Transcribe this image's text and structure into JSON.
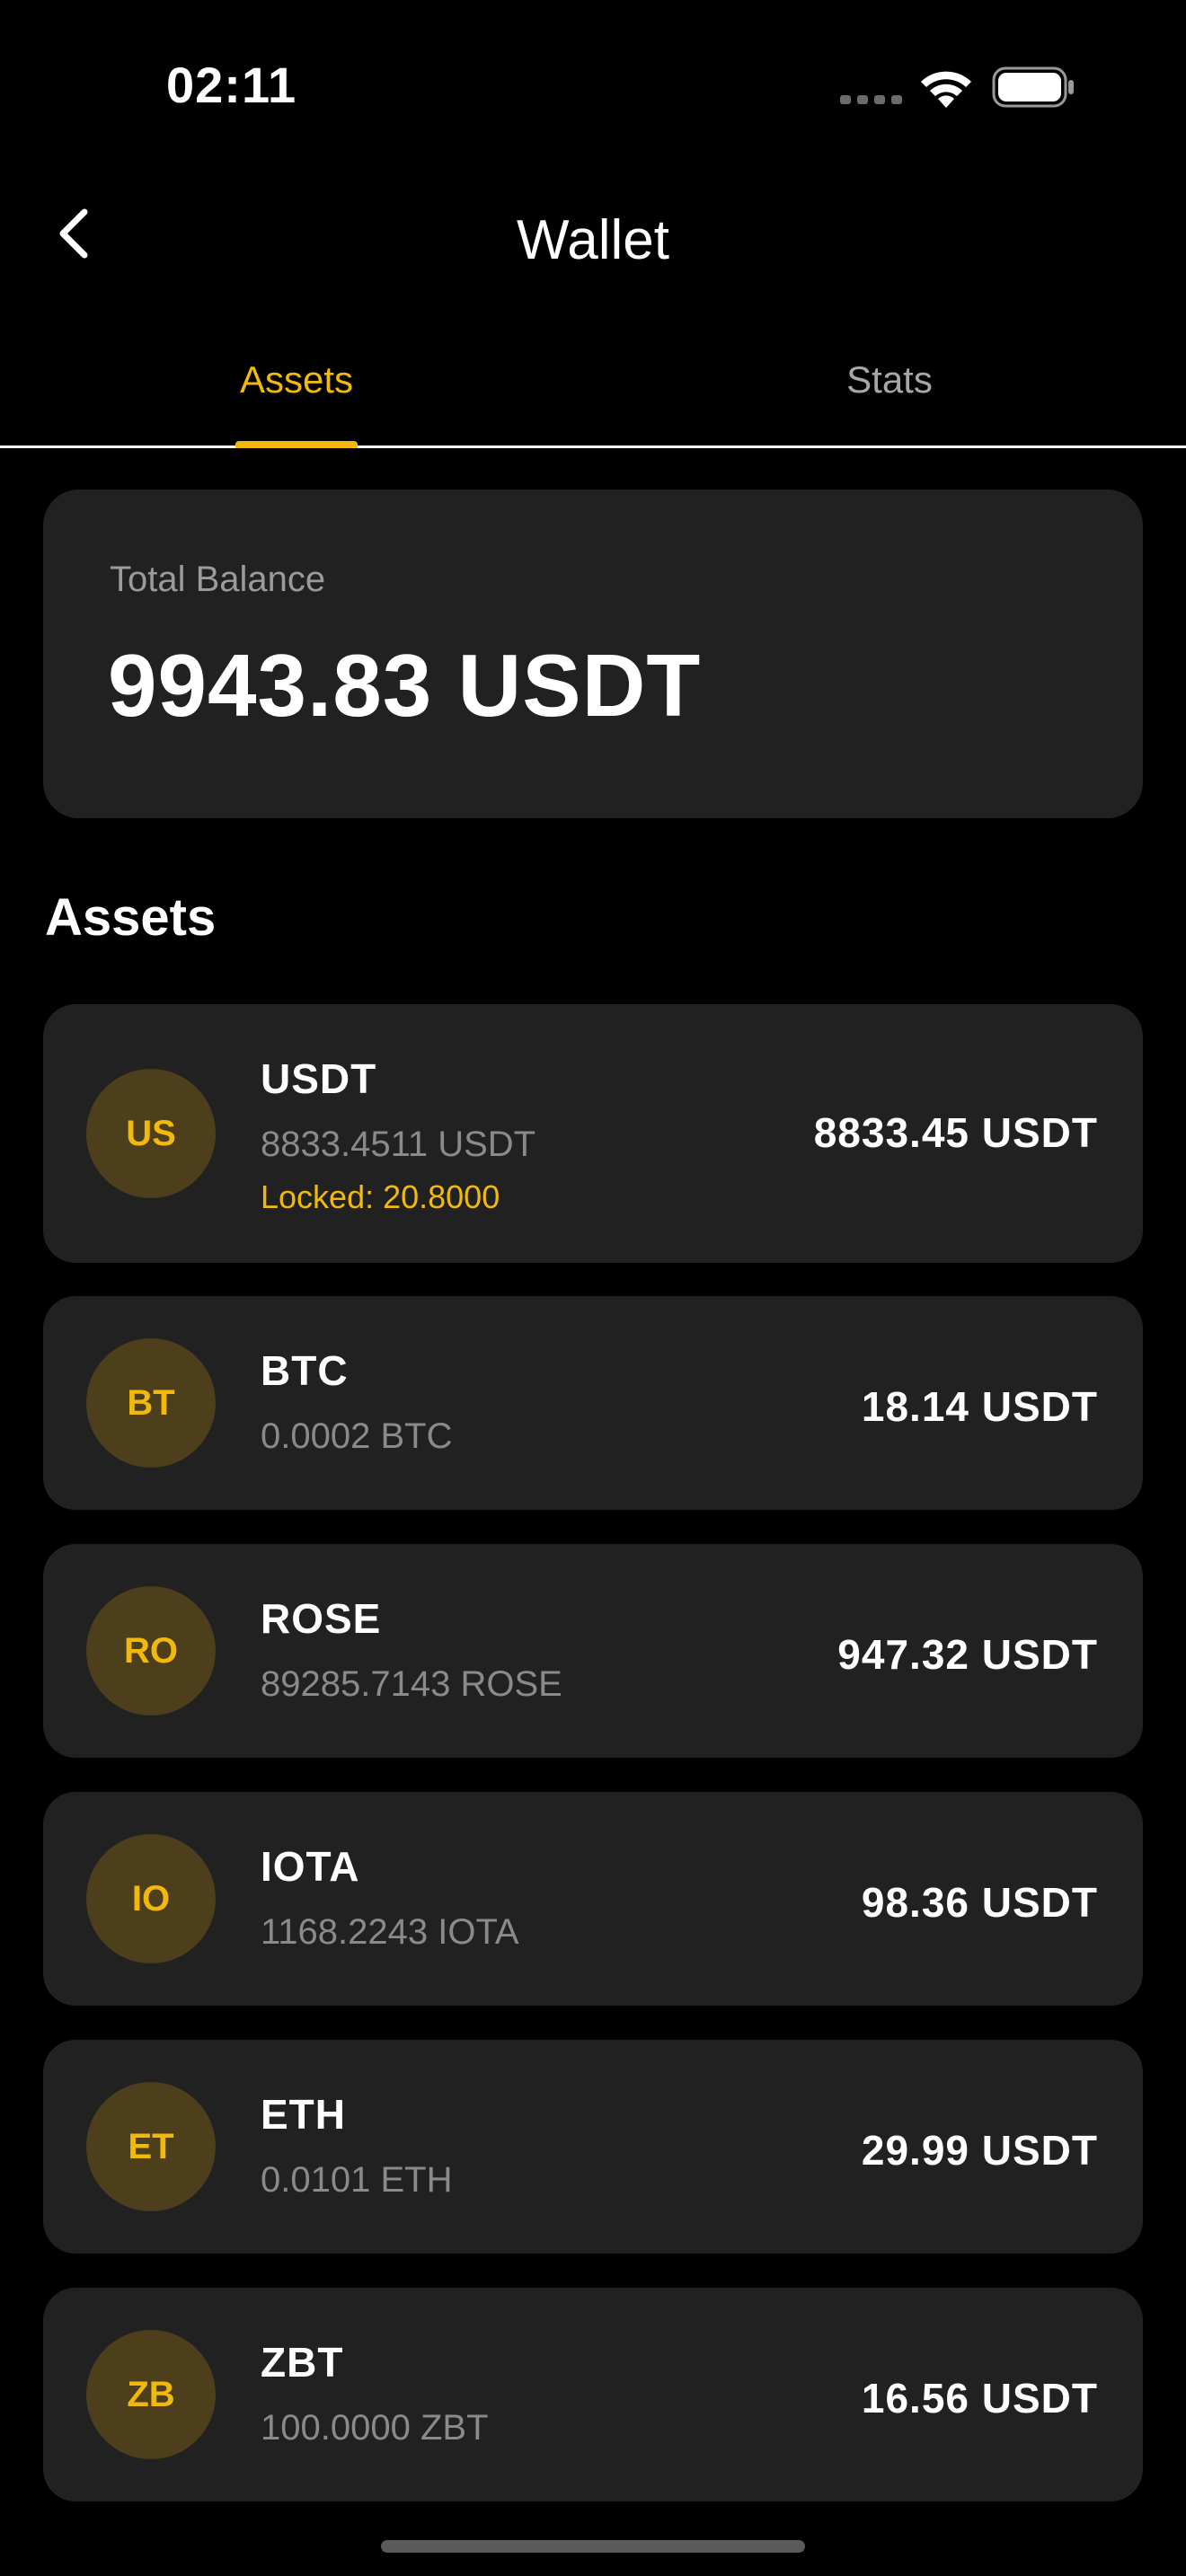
{
  "status_bar": {
    "time": "02:11",
    "icons": [
      "signal-dots-icon",
      "wifi-icon",
      "battery-icon"
    ]
  },
  "header": {
    "back_icon": "chevron-left-icon",
    "title": "Wallet"
  },
  "tabs": [
    {
      "label": "Assets",
      "active": true
    },
    {
      "label": "Stats",
      "active": false
    }
  ],
  "balance": {
    "label": "Total Balance",
    "value": "9943.83 USDT"
  },
  "assets_section": {
    "title": "Assets",
    "items": [
      {
        "initials": "US",
        "symbol": "USDT",
        "amount": "8833.4511 USDT",
        "locked": "Locked: 20.8000",
        "value": "8833.45 USDT"
      },
      {
        "initials": "BT",
        "symbol": "BTC",
        "amount": "0.0002 BTC",
        "value": "18.14 USDT"
      },
      {
        "initials": "RO",
        "symbol": "ROSE",
        "amount": "89285.7143 ROSE",
        "value": "947.32 USDT"
      },
      {
        "initials": "IO",
        "symbol": "IOTA",
        "amount": "1168.2243 IOTA",
        "value": "98.36 USDT"
      },
      {
        "initials": "ET",
        "symbol": "ETH",
        "amount": "0.0101 ETH",
        "value": "29.99 USDT"
      },
      {
        "initials": "ZB",
        "symbol": "ZBT",
        "amount": "100.0000 ZBT",
        "value": "16.56 USDT"
      }
    ]
  },
  "colors": {
    "accent": "#f0b90b",
    "background": "#000000",
    "card": "#212121",
    "avatar_bg": "#4d3f1c",
    "muted_text": "#8a8a8a"
  }
}
